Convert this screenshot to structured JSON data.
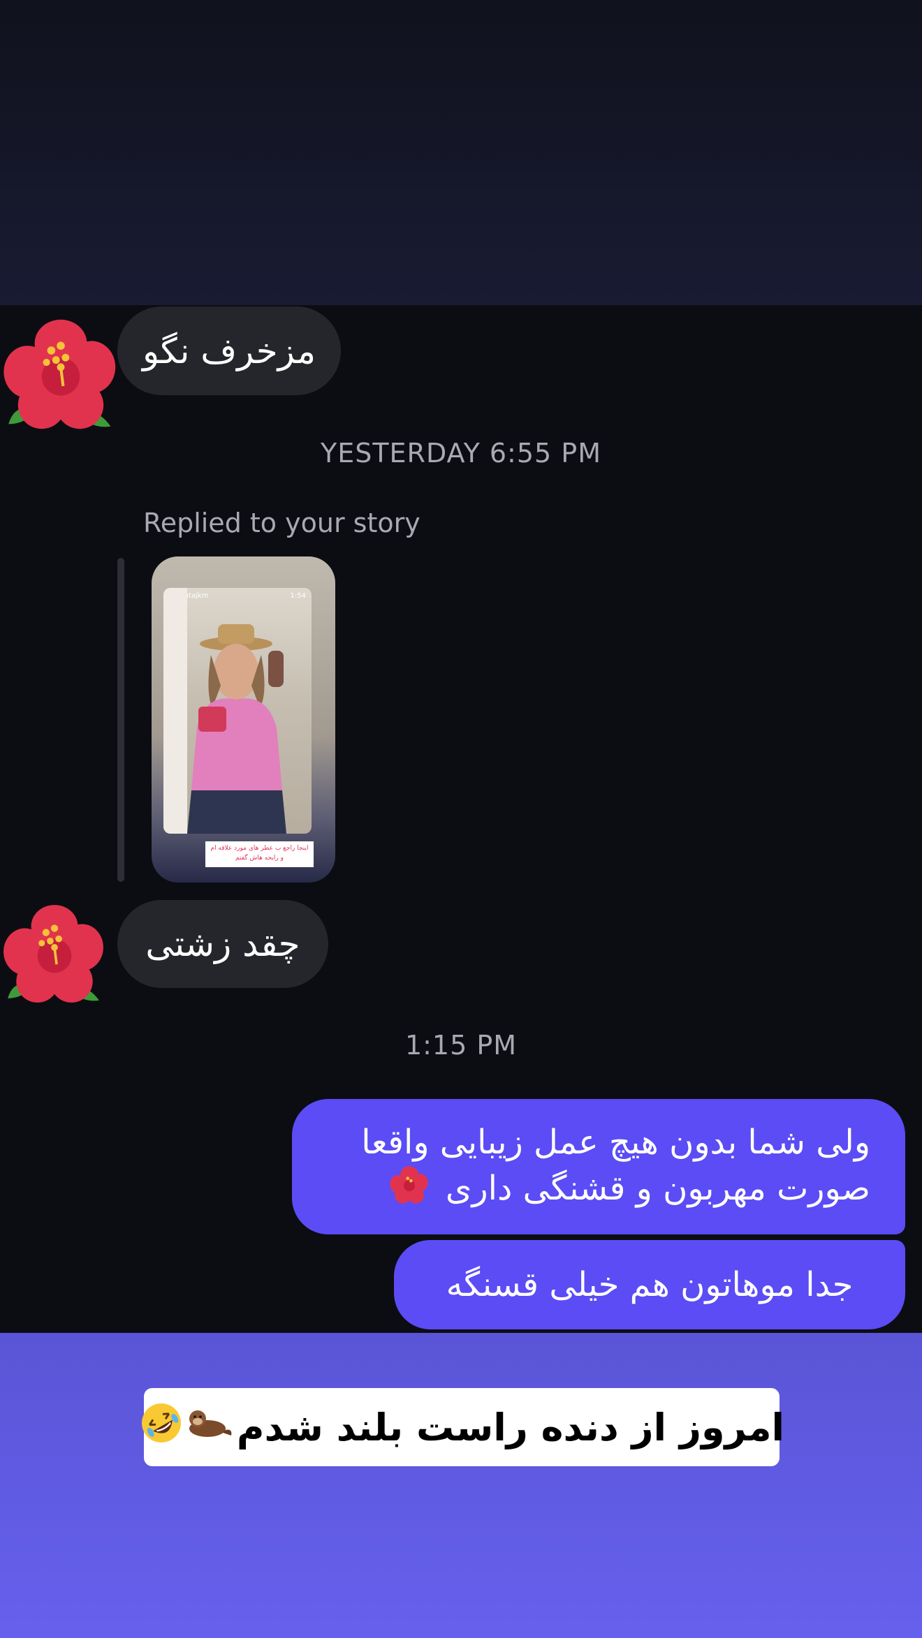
{
  "messages": {
    "incoming_1": "مزخرف نگو",
    "timestamp_1": "YESTERDAY 6:55 PM",
    "reply_label": "Replied to your story",
    "story_preview": {
      "username": "zahratajkm",
      "time": "1:54",
      "sticker_text": "اینجا راجع ب عطر های مورد علاقه ام و رایحه هاش گفتم"
    },
    "incoming_2": "چقد زشتی",
    "timestamp_2": "1:15 PM",
    "outgoing_1": "ولی شما بدون هیچ عمل زیبایی واقعا صورت مهربون و قشنگی داری",
    "outgoing_2": "جدا موهاتون هم خیلی قسنگه"
  },
  "caption": {
    "text": "امروز از دنده راست بلند شدم"
  },
  "icons": {
    "avatar": "hibiscus-icon",
    "emoji_1": "otter-icon",
    "emoji_2": "rofl-face-icon"
  },
  "colors": {
    "outgoing_bubble": "#5b4cf5",
    "incoming_bubble": "#25262b",
    "chat_bg": "#0c0d12",
    "bottom_bg": "#6660ee"
  }
}
